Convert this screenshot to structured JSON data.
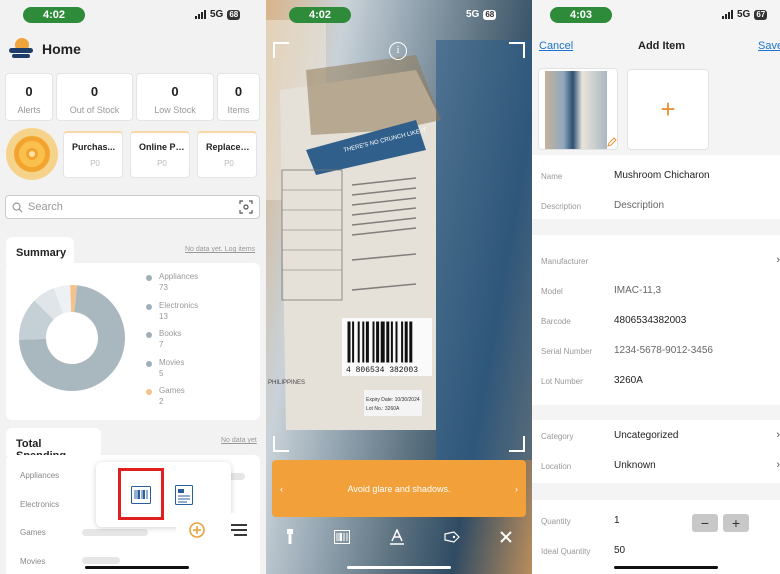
{
  "screen1": {
    "status": {
      "time": "4:02",
      "network": "5G",
      "battery": "68"
    },
    "header": {
      "title": "Home"
    },
    "stats": [
      {
        "value": "0",
        "label": "Alerts"
      },
      {
        "value": "0",
        "label": "Out of Stock"
      },
      {
        "value": "0",
        "label": "Low Stock"
      },
      {
        "value": "0",
        "label": "Items"
      }
    ],
    "cards": [
      {
        "title": "Purchas...",
        "value": "P0"
      },
      {
        "title": "Online Pr...",
        "value": "P0"
      },
      {
        "title": "Replacem...",
        "value": "P0"
      }
    ],
    "search": {
      "placeholder": "Search"
    },
    "summary": {
      "title": "Summary",
      "no_data": "No data yet. Log items",
      "chart_data": {
        "type": "pie",
        "categories": [
          "Appliances",
          "Electronics",
          "Books",
          "Movies",
          "Games"
        ],
        "values": [
          73,
          13,
          7,
          5,
          2
        ],
        "colors": [
          "#a9b7bf",
          "#c5d0d6",
          "#dfe5e8",
          "#eef1f3",
          "#f4c38c"
        ],
        "legend": "right"
      }
    },
    "spending": {
      "title": "Total Spending",
      "no_data": "No data yet",
      "rows": [
        "Appliances",
        "Electronics",
        "Games",
        "Movies"
      ]
    },
    "popup": {
      "options": [
        "barcode-scan-icon",
        "document-icon"
      ]
    }
  },
  "screen2": {
    "status": {
      "time": "4:02",
      "network": "5G",
      "battery": "68"
    },
    "tip": {
      "text": "Avoid glare and shadows.",
      "prev": "‹",
      "next": "›"
    },
    "tools": [
      "flashlight-icon",
      "barcode-icon",
      "text-icon",
      "label-icon",
      "close-icon"
    ],
    "product_text": {
      "banner": "THERE'S NO CRUNCH LIKE IT",
      "barcode": "4 806534 382003",
      "origin": "PHILIPPINES",
      "expiry": "Expiry Date: 10/30/2024",
      "lot": "Lot No.: 3260A"
    }
  },
  "screen3": {
    "status": {
      "time": "4:03",
      "network": "5G",
      "battery": "67"
    },
    "nav": {
      "cancel": "Cancel",
      "title": "Add Item",
      "save": "Save"
    },
    "fields": [
      {
        "label": "Name",
        "value": "Mushroom Chicharon",
        "muted": false,
        "chevron": false
      },
      {
        "label": "Description",
        "value": "Description",
        "muted": true,
        "chevron": false
      },
      {
        "label": "Manufacturer",
        "value": "",
        "muted": false,
        "chevron": true
      },
      {
        "label": "Model",
        "value": "IMAC-11,3",
        "muted": true,
        "chevron": false
      },
      {
        "label": "Barcode",
        "value": "4806534382003",
        "muted": false,
        "chevron": false
      },
      {
        "label": "Serial Number",
        "value": "1234-5678-9012-3456",
        "muted": true,
        "chevron": false
      },
      {
        "label": "Lot Number",
        "value": "3260A",
        "muted": false,
        "chevron": false
      },
      {
        "label": "Category",
        "value": "Uncategorized",
        "muted": false,
        "chevron": true
      },
      {
        "label": "Location",
        "value": "Unknown",
        "muted": false,
        "chevron": true
      },
      {
        "label": "Quantity",
        "value": "1",
        "muted": false,
        "chevron": false
      },
      {
        "label": "Ideal Quantity",
        "value": "50",
        "muted": false,
        "chevron": false
      }
    ],
    "stepper": {
      "minus": "−",
      "plus": "+"
    },
    "add_photo": "+"
  }
}
